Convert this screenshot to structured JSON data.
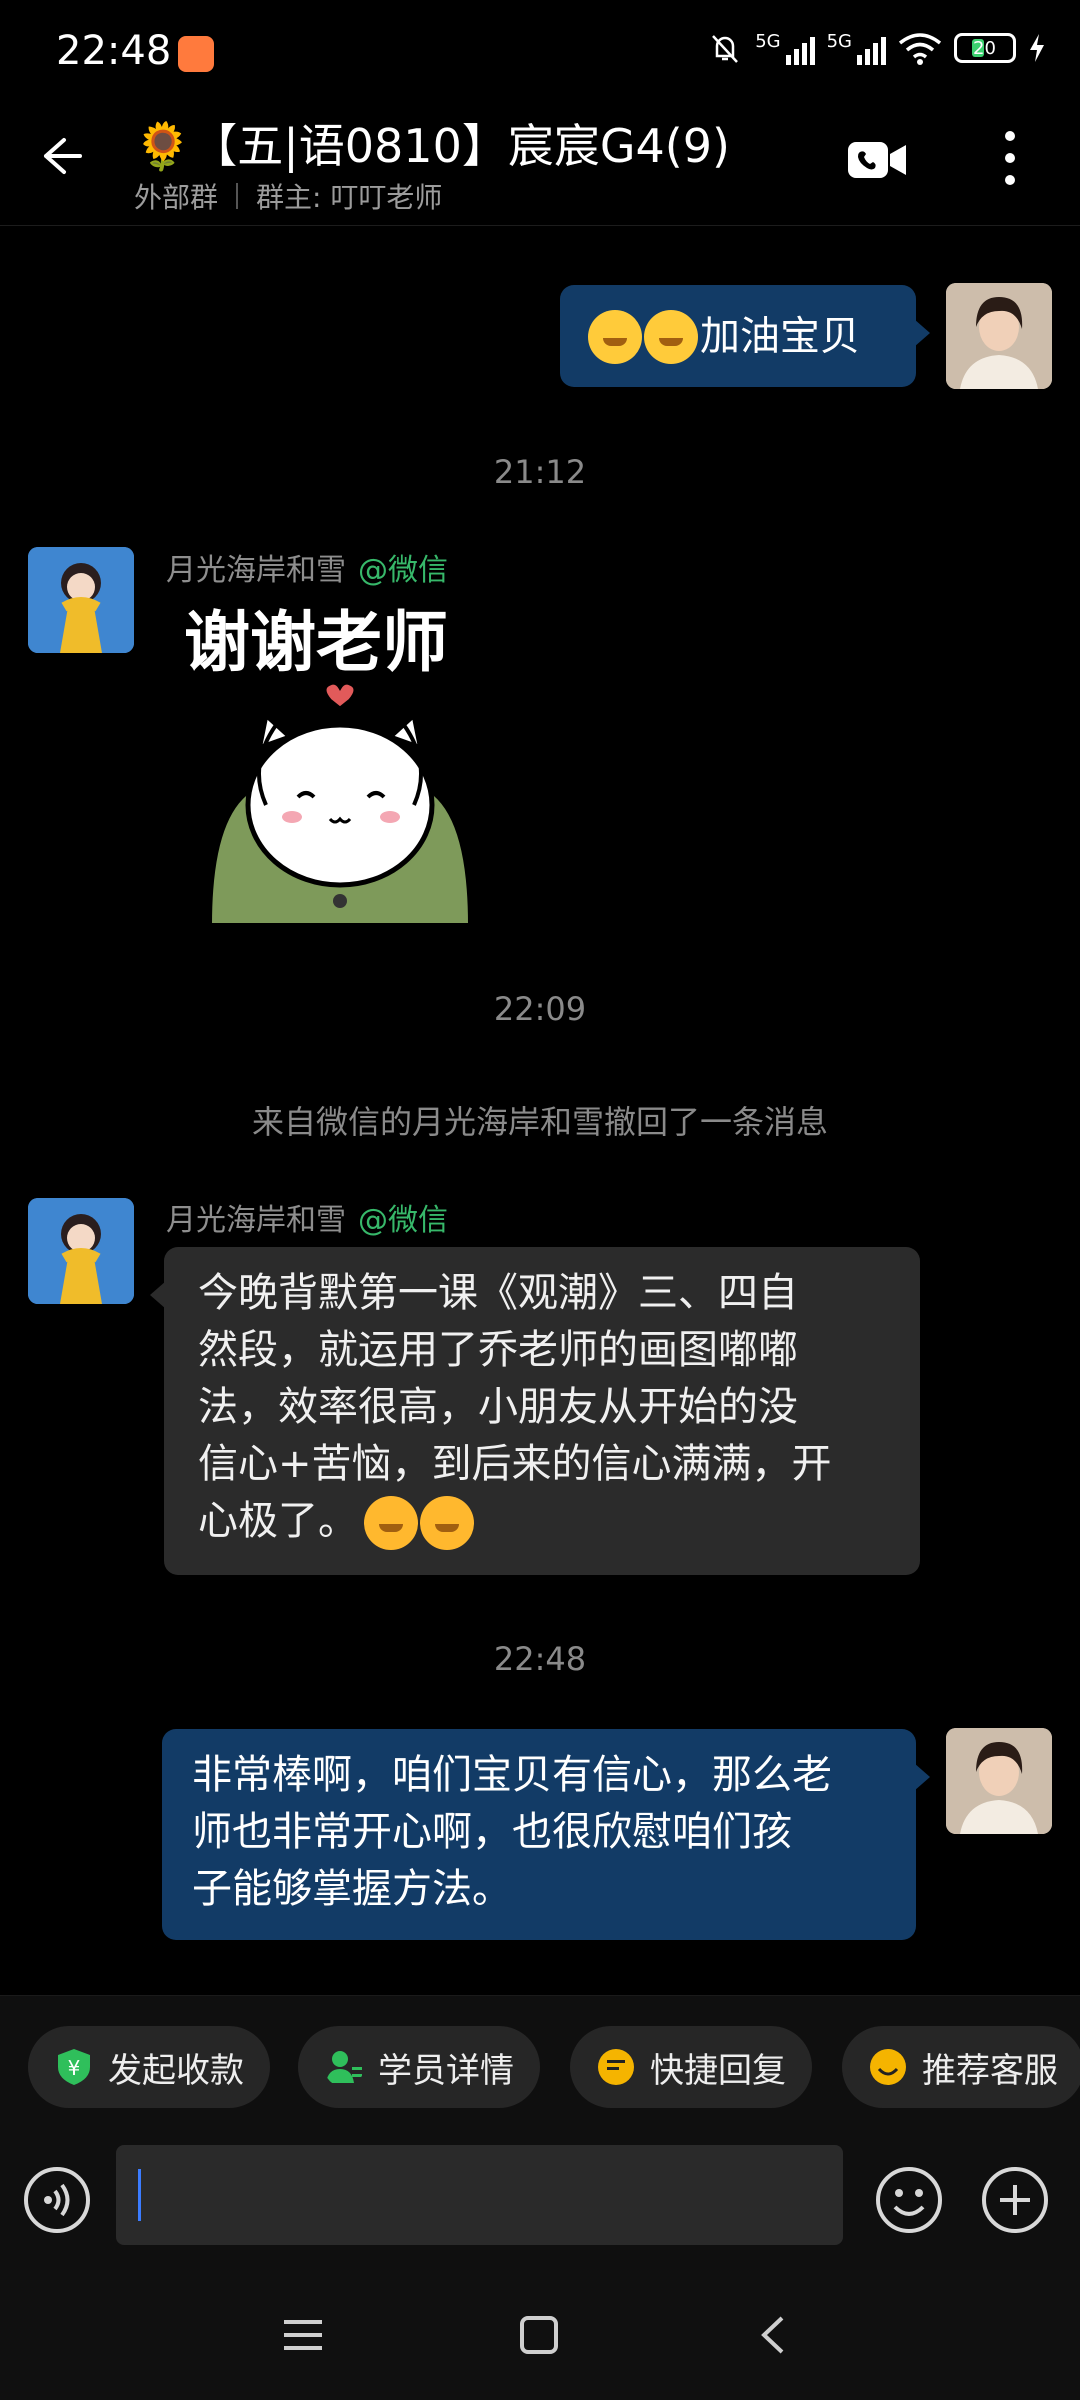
{
  "status_bar": {
    "time": "22:48",
    "network_1": "5G",
    "network_2": "5G",
    "battery": "20"
  },
  "header": {
    "title": "🌻【五|语0810】宸宸G4(9)",
    "group_type": "外部群",
    "owner": "群主: 叮叮老师"
  },
  "messages": [
    {
      "type": "outgoing_text",
      "text": "加油宝贝",
      "emoji_prefix": "shushing-face-icon x2"
    },
    {
      "type": "time",
      "text": "21:12"
    },
    {
      "type": "incoming_sticker",
      "sender": "月光海岸和雪",
      "source_tag": "@微信",
      "sticker_text": "谢谢老师"
    },
    {
      "type": "time",
      "text": "22:09"
    },
    {
      "type": "system",
      "text": "来自微信的月光海岸和雪撤回了一条消息"
    },
    {
      "type": "incoming_text",
      "sender": "月光海岸和雪",
      "source_tag": "@微信",
      "lines": [
        "今晚背默第一课《观潮》三、四自",
        "然段，就运用了乔老师的画图嘟嘟",
        "法，效率很高，小朋友从开始的没",
        "信心+苦恼，到后来的信心满满，开",
        "心极了。"
      ]
    },
    {
      "type": "time",
      "text": "22:48"
    },
    {
      "type": "outgoing_text",
      "lines": [
        "非常棒啊，咱们宝贝有信心，那么老",
        "师也非常开心啊，也很欣慰咱们孩",
        "子能够掌握方法。"
      ]
    }
  ],
  "quick_actions": [
    {
      "label": "发起收款",
      "icon": "payment-shield-icon",
      "color": "#2fbf5b"
    },
    {
      "label": "学员详情",
      "icon": "student-profile-icon",
      "color": "#2fbf5b"
    },
    {
      "label": "快捷回复",
      "icon": "quick-reply-icon",
      "color": "#f5b400"
    },
    {
      "label": "推荐客服",
      "icon": "service-smile-icon",
      "color": "#f5b400"
    }
  ],
  "input": {
    "value": "",
    "placeholder": ""
  },
  "colors": {
    "outgoing_bubble": "#123b66",
    "incoming_bubble": "#2b2b2b",
    "wechat_tag": "#37b86a"
  }
}
